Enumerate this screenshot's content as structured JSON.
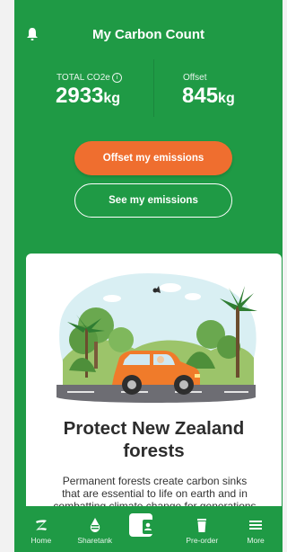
{
  "header": {
    "title": "My Carbon Count"
  },
  "stats": {
    "total_label": "TOTAL CO2e",
    "total_value": "2933",
    "total_unit": "kg",
    "offset_label": "Offset",
    "offset_value": "845",
    "offset_unit": "kg"
  },
  "actions": {
    "offset_label": "Offset my emissions",
    "see_label": "See my emissions"
  },
  "card": {
    "title_line1": "Protect New Zealand",
    "title_line2": "forests",
    "body_line1": "Permanent forests create carbon sinks",
    "body_line2": "that are essential to life on earth and in",
    "body_line3": "combatting climate change for generations"
  },
  "tabs": [
    {
      "label": "Home",
      "icon": "z-logo-icon"
    },
    {
      "label": "Sharetank",
      "icon": "fuel-drop-icon"
    },
    {
      "label": "",
      "icon": "phone-card-icon"
    },
    {
      "label": "Pre-order",
      "icon": "coffee-cup-icon"
    },
    {
      "label": "More",
      "icon": "menu-icon"
    }
  ],
  "colors": {
    "brand_green": "#1f9a45",
    "accent_orange": "#ef6e2f"
  }
}
